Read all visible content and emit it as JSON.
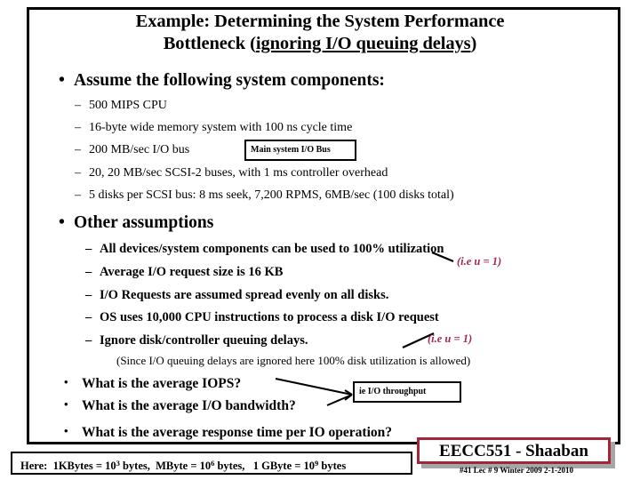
{
  "slide": {
    "title_line1": "Example: Determining the System Performance",
    "title_line2_prefix": "Bottleneck (",
    "title_line2_underlined": "ignoring I/O queuing delays",
    "title_line2_suffix": ")",
    "frame_color": "#000000"
  },
  "section1": {
    "heading": "Assume the following system components:",
    "bullet_glyph": "•",
    "dash_glyph": "–",
    "items": [
      "500 MIPS CPU",
      "16-byte wide memory system with 100 ns cycle time",
      "200 MB/sec  I/O bus",
      "20,  20 MB/sec SCSI-2 buses, with 1 ms controller overhead",
      "5 disks per SCSI  bus: 8 ms seek, 7,200 RPMS, 6MB/sec  (100 disks total)"
    ]
  },
  "section2": {
    "heading": "Other assumptions",
    "bullet_glyph": "•",
    "dash_glyph": "–",
    "items": [
      "All devices/system components can be used to 100% utilization",
      "Average I/O request size is 16 KB",
      "I/O Requests are assumed spread evenly on all disks.",
      "OS uses 10,000 CPU instructions to process a disk I/O request",
      "Ignore disk/controller queuing delays."
    ],
    "parenthetical": "(Since I/O queuing delays are ignored here 100% disk utilization is allowed)"
  },
  "questions": {
    "bullet_glyph": "•",
    "items": [
      "What is the average IOPS?",
      "What is the average I/O bandwidth?",
      "What is the average response time per IO operation?"
    ]
  },
  "callouts": {
    "main_io_bus": "Main system I/O Bus",
    "io_throughput": "ie  I/O throughput"
  },
  "annotations": {
    "color": "#a32654",
    "note1": "(i.e  u = 1)",
    "note2": "(i.e  u = 1)"
  },
  "footnote": {
    "label": "Here:",
    "kb_prefix": "1KBytes = 10",
    "kb_exp": "3",
    "kb_suffix": " bytes,",
    "mb_prefix": "MByte = 10",
    "mb_exp": "6",
    "mb_suffix": " bytes,",
    "gb_prefix": "1 GByte = 10",
    "gb_exp": "9",
    "gb_suffix": " bytes"
  },
  "branding": {
    "course": "EECC551 - Shaaban",
    "meta": "#41   Lec # 9  Winter 2009  2-1-2010",
    "accent_color": "#a32638",
    "shadow_color": "#a6a6a6"
  }
}
